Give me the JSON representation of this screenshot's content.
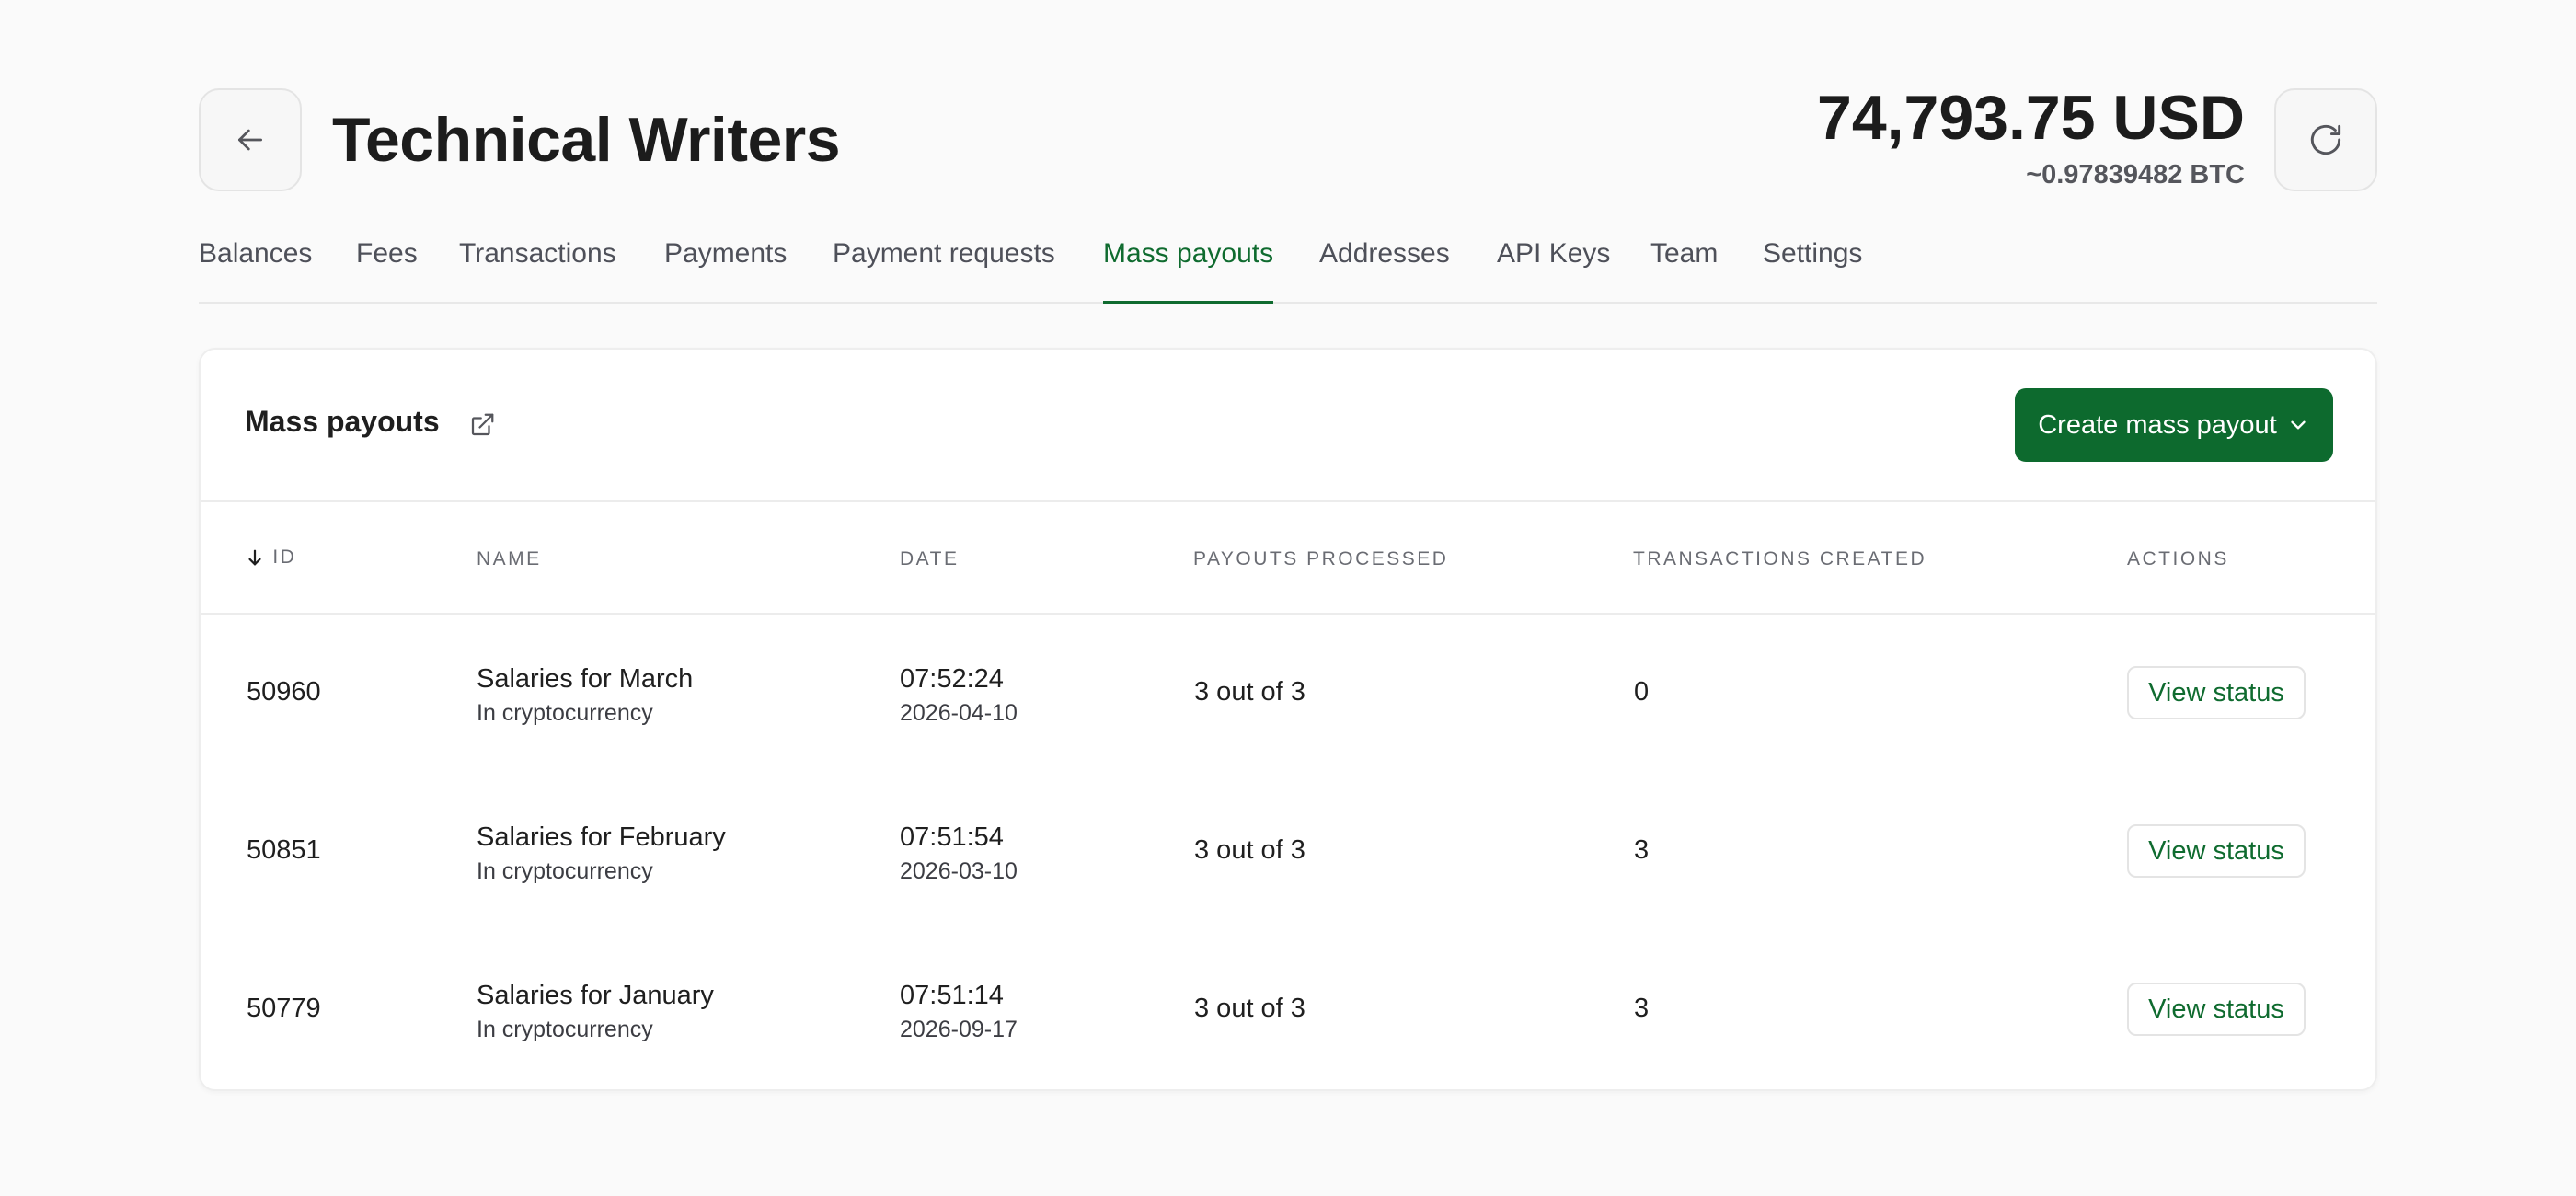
{
  "header": {
    "title": "Technical Writers",
    "balance_usd": "74,793.75 USD",
    "balance_btc": "~0.97839482 BTC"
  },
  "tabs": [
    {
      "label": "Balances",
      "active": false
    },
    {
      "label": "Fees",
      "active": false
    },
    {
      "label": "Transactions",
      "active": false
    },
    {
      "label": "Payments",
      "active": false
    },
    {
      "label": "Payment requests",
      "active": false
    },
    {
      "label": "Mass payouts",
      "active": true
    },
    {
      "label": "Addresses",
      "active": false
    },
    {
      "label": "API Keys",
      "active": false
    },
    {
      "label": "Team",
      "active": false
    },
    {
      "label": "Settings",
      "active": false
    }
  ],
  "card": {
    "title": "Mass payouts",
    "create_label": "Create mass payout",
    "columns": {
      "id": "ID",
      "name": "NAME",
      "date": "DATE",
      "processed": "PAYOUTS PROCESSED",
      "transactions": "TRANSACTIONS CREATED",
      "actions": "ACTIONS"
    },
    "rows": [
      {
        "id": "50960",
        "name": "Salaries for March",
        "sub": "In cryptocurrency",
        "time": "07:52:24",
        "date": "2026-04-10",
        "processed": "3 out of 3",
        "transactions": "0",
        "action": "View status"
      },
      {
        "id": "50851",
        "name": "Salaries for February",
        "sub": "In cryptocurrency",
        "time": "07:51:54",
        "date": "2026-03-10",
        "processed": "3 out of 3",
        "transactions": "3",
        "action": "View status"
      },
      {
        "id": "50779",
        "name": "Salaries for January",
        "sub": "In cryptocurrency",
        "time": "07:51:14",
        "date": "2026-09-17",
        "processed": "3 out of 3",
        "transactions": "3",
        "action": "View status"
      }
    ]
  },
  "colors": {
    "accent": "#0d6a2e",
    "accent_text": "#0f6b2f",
    "background": "#fafafa"
  },
  "icons": {
    "back": "arrow-left-icon",
    "refresh": "refresh-icon",
    "external": "external-link-icon",
    "dropdown": "chevron-down-icon",
    "sort": "arrow-down-icon"
  }
}
